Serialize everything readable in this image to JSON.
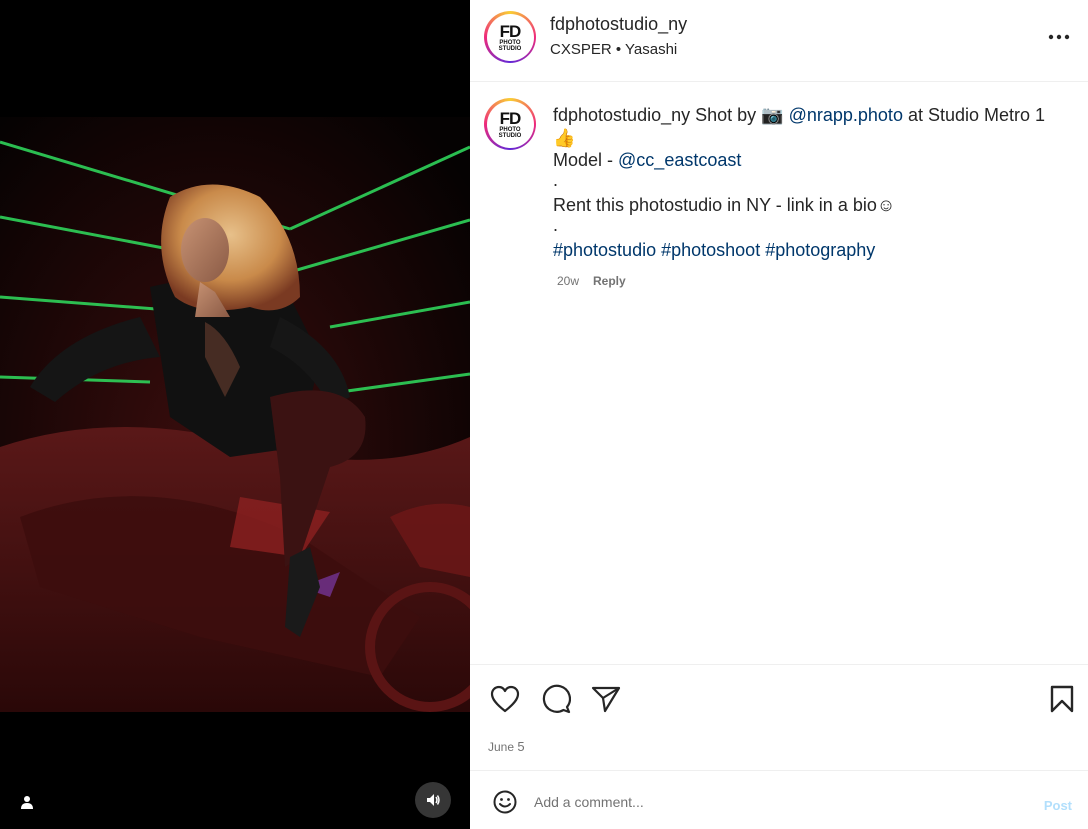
{
  "post": {
    "username": "fdphotostudio_ny",
    "audio": "CXSPER • Yasashi",
    "avatar_text": {
      "big": "FD",
      "line1": "PHOTO",
      "line2": "STUDIO"
    }
  },
  "caption": {
    "username": "fdphotostudio_ny",
    "text_1": " Shot by ",
    "camera_emoji": "📷",
    "mention_1": "@nrapp.photo",
    "text_2": " at Studio Metro 1 ",
    "thumbs_emoji": "👍",
    "model_prefix": "Model - ",
    "mention_2": "@cc_eastcoast",
    "dot": ".",
    "rent_text": "Rent this photostudio in NY - link in a bio",
    "smile": "☺",
    "hashtag_1": "#photostudio",
    "hashtag_2": "#photoshoot",
    "hashtag_3": "#photography",
    "age": "20w",
    "reply_label": "Reply"
  },
  "actions": {
    "icons": [
      "heart-icon",
      "comment-icon",
      "share-icon",
      "bookmark-icon"
    ]
  },
  "date": {
    "month": "June",
    "day": "5"
  },
  "comment": {
    "placeholder": "Add a comment...",
    "post_label": "Post"
  },
  "colors": {
    "link": "#00376b",
    "post_disabled": "#b2dffc",
    "meta": "#737373"
  }
}
